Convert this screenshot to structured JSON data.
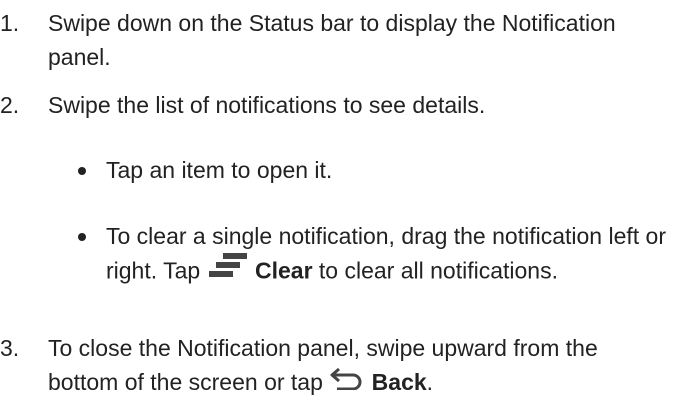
{
  "steps": [
    {
      "number": "1.",
      "text": "Swipe down on the Status bar to display the Notification panel."
    },
    {
      "number": "2.",
      "text": "Swipe the list of notifications to see details.",
      "bullets": [
        {
          "text": "Tap an item to open it."
        },
        {
          "text_before": "To clear a single notification, drag the notification left or right. Tap",
          "icon": "clear-all-icon",
          "action_label": "Clear",
          "text_after": "to clear all notifications."
        }
      ]
    },
    {
      "number": "3.",
      "text_before": "To close the Notification panel, swipe upward from the bottom of the screen or tap",
      "icon": "back-icon",
      "action_label": "Back",
      "text_after": "."
    }
  ],
  "colors": {
    "text": "#222222",
    "icon": "#444444"
  }
}
